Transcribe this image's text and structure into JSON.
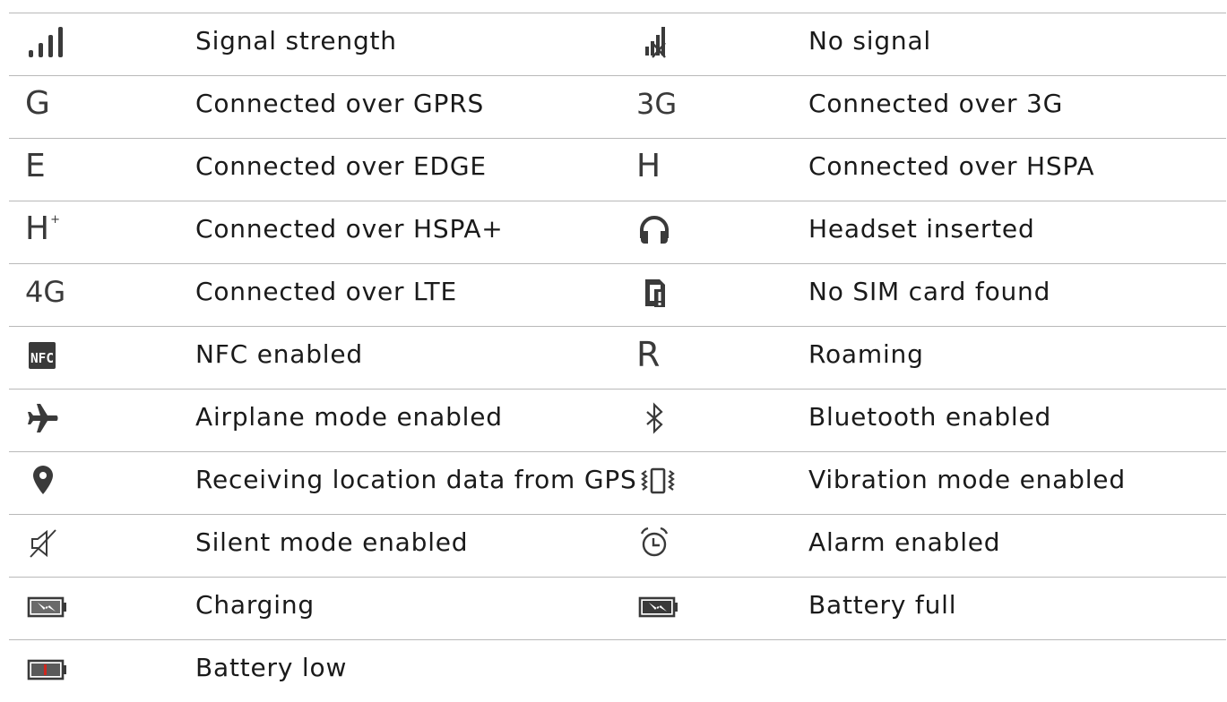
{
  "rows": [
    {
      "left": {
        "icon": "signal-strength-icon",
        "label": "Signal strength"
      },
      "right": {
        "icon": "no-signal-icon",
        "label": "No signal"
      }
    },
    {
      "left": {
        "icon": "gprs-icon",
        "glyph": "G",
        "label": "Connected over GPRS"
      },
      "right": {
        "icon": "3g-icon",
        "glyph": "3G",
        "label": "Connected over 3G"
      }
    },
    {
      "left": {
        "icon": "edge-icon",
        "glyph": "E",
        "label": "Connected over EDGE"
      },
      "right": {
        "icon": "hspa-icon",
        "glyph": "H",
        "label": "Connected over HSPA"
      }
    },
    {
      "left": {
        "icon": "hspa-plus-icon",
        "glyph": "H",
        "glyph_sup": "+",
        "label": "Connected over HSPA+"
      },
      "right": {
        "icon": "headset-icon",
        "label": "Headset inserted"
      }
    },
    {
      "left": {
        "icon": "4g-icon",
        "glyph": "4G",
        "label": "Connected over LTE"
      },
      "right": {
        "icon": "no-sim-icon",
        "label": "No SIM card found"
      }
    },
    {
      "left": {
        "icon": "nfc-icon",
        "glyph": "NFC",
        "label": "NFC enabled"
      },
      "right": {
        "icon": "roaming-icon",
        "glyph": "R",
        "label": "Roaming"
      }
    },
    {
      "left": {
        "icon": "airplane-icon",
        "label": "Airplane mode enabled"
      },
      "right": {
        "icon": "bluetooth-icon",
        "label": "Bluetooth enabled"
      }
    },
    {
      "left": {
        "icon": "location-pin-icon",
        "label": "Receiving location data from GPS"
      },
      "right": {
        "icon": "vibration-icon",
        "label": "Vibration mode enabled"
      }
    },
    {
      "left": {
        "icon": "silent-mode-icon",
        "label": "Silent mode enabled"
      },
      "right": {
        "icon": "alarm-icon",
        "label": "Alarm enabled"
      }
    },
    {
      "left": {
        "icon": "battery-charging-icon",
        "label": "Charging"
      },
      "right": {
        "icon": "battery-full-icon",
        "label": "Battery full"
      }
    },
    {
      "left": {
        "icon": "battery-low-icon",
        "label": "Battery low"
      },
      "right": null
    }
  ],
  "colors": {
    "icon": "#3a3a3a",
    "rule": "#b9b9b9",
    "battery_low_accent": "#d0271d"
  }
}
